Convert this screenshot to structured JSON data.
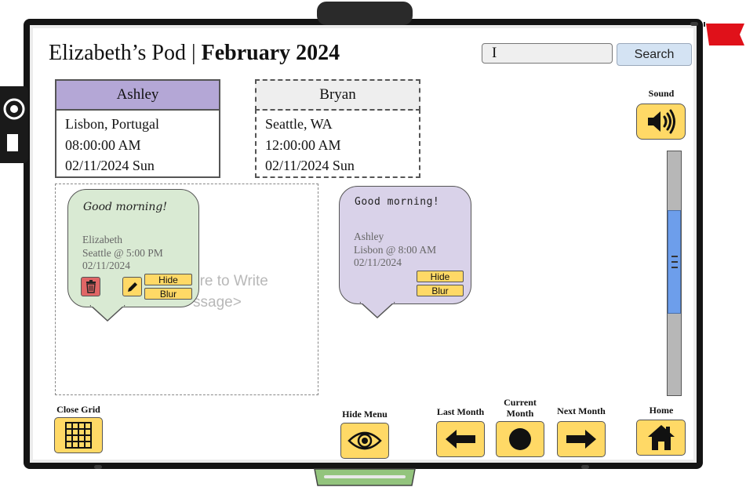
{
  "header": {
    "pod_title": "Elizabeth’s Pod",
    "separator": "|",
    "month_title": "February 2024"
  },
  "search": {
    "value": "I",
    "button_label": "Search"
  },
  "clocks": [
    {
      "name": "Ashley",
      "location": "Lisbon, Portugal",
      "time": "08:00:00 AM",
      "date": "02/11/2024 Sun",
      "color": "#b4a7d6"
    },
    {
      "name": "Bryan",
      "location": "Seattle, WA",
      "time": "12:00:00 AM",
      "date": "02/11/2024 Sun",
      "color": "#eeeeee"
    }
  ],
  "grid": {
    "placeholder_line1": "ere to Write",
    "placeholder_line2": "ssage>"
  },
  "notes": [
    {
      "greeting": "Good morning!",
      "author": "Elizabeth",
      "location_time": "Seattle @ 5:00 PM",
      "date": "02/11/2024",
      "hide_label": "Hide",
      "blur_label": "Blur",
      "color": "#d9ead3"
    },
    {
      "greeting": "Good morning!",
      "author": "Ashley",
      "location_time": "Lisbon @ 8:00 AM",
      "date": "02/11/2024",
      "hide_label": "Hide",
      "blur_label": "Blur",
      "color": "#d9d2e9"
    }
  ],
  "sidebar": {
    "sound_label": "Sound",
    "sound_icon": "speaker-icon"
  },
  "toolbar": {
    "close_grid_label": "Close Grid",
    "hide_menu_label": "Hide Menu",
    "last_month_label": "Last Month",
    "current_month_label_1": "Current",
    "current_month_label_2": "Month",
    "next_month_label": "Next Month",
    "home_label": "Home"
  },
  "colors": {
    "button_yellow": "#ffd966",
    "search_button": "#d4e3f3",
    "scroll_thumb": "#6d9eeb",
    "flag": "#e0111a",
    "tray": "#93c47d",
    "delete_red": "#e06666"
  }
}
